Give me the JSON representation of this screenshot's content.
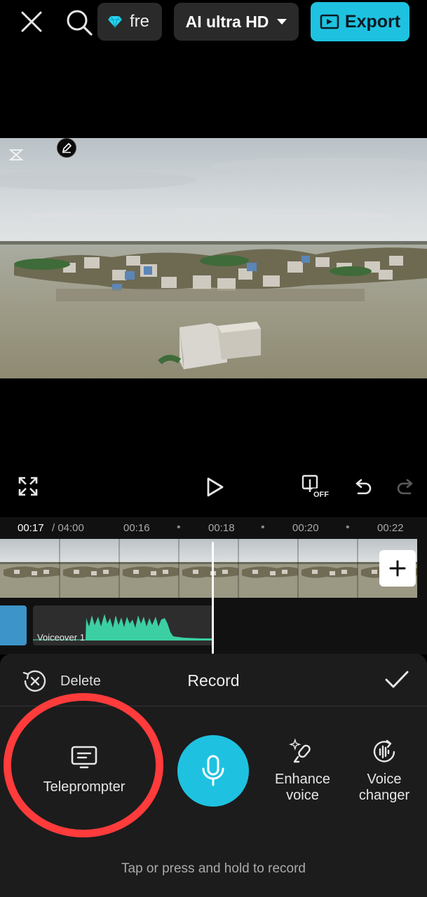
{
  "topbar": {
    "close_icon": "close-icon",
    "search_icon": "search-icon",
    "pro_label": "fre",
    "pro_icon": "diamond-icon",
    "quality_label": "AI ultra HD",
    "export_label": "Export",
    "accent_color": "#1ec2e0"
  },
  "controls": {
    "fullscreen_icon": "fullscreen-icon",
    "play_icon": "play-icon",
    "keyframe_icon": "keyframe-off-icon",
    "keyframe_badge": "OFF",
    "undo_icon": "undo-icon",
    "redo_icon": "redo-icon"
  },
  "ruler": {
    "current_time": "00:17",
    "total_time": "/ 04:00",
    "ticks": [
      "00:16",
      "00:18",
      "00:20",
      "00:22"
    ]
  },
  "timeline": {
    "voice_clip_label": "Voiceover 1",
    "add_clip_icon": "plus-icon"
  },
  "panel": {
    "delete_label": "Delete",
    "title": "Record",
    "confirm_icon": "checkmark-icon",
    "tools": {
      "teleprompter": "Teleprompter",
      "enhance_line1": "Enhance",
      "enhance_line2": "voice",
      "changer_line1": "Voice",
      "changer_line2": "changer"
    },
    "hint": "Tap or press and hold to record"
  }
}
